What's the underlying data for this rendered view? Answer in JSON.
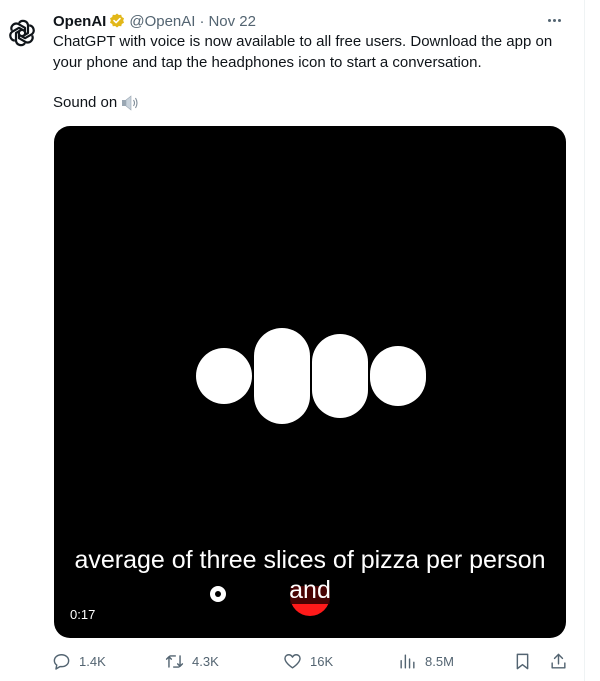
{
  "tweet": {
    "author_name": "OpenAI",
    "verified": true,
    "badge_color": "#e2b719",
    "handle": "@OpenAI",
    "separator": "·",
    "date": "Nov 22",
    "more_icon": "more-horizontal-icon",
    "text_lines": [
      "ChatGPT with voice is now available to all free users. Download the app on",
      "your phone and tap the headphones icon to start a conversation."
    ],
    "sound_label": "Sound on",
    "sound_icon": "speaker-icon"
  },
  "media": {
    "caption_line1": "average of three slices of pizza per person",
    "caption_line2": "and",
    "timestamp": "0:17",
    "background": "#000000",
    "accent_red": "#ff1a1a"
  },
  "actions": {
    "reply": {
      "icon": "reply-icon",
      "count": "1.4K"
    },
    "retweet": {
      "icon": "retweet-icon",
      "count": "4.3K"
    },
    "like": {
      "icon": "heart-icon",
      "count": "16K"
    },
    "views": {
      "icon": "views-icon",
      "count": "8.5M"
    },
    "bookmark": {
      "icon": "bookmark-icon"
    },
    "share": {
      "icon": "share-icon"
    }
  }
}
